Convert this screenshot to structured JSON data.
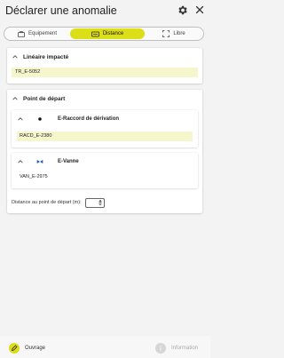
{
  "header": {
    "title": "Déclarer une anomalie",
    "settings_icon": "gear-icon",
    "close_icon": "close-icon"
  },
  "tabs": [
    {
      "label": "Equipement",
      "icon": "equipment-icon",
      "active": false
    },
    {
      "label": "Distance",
      "icon": "distance-icon",
      "active": true
    },
    {
      "label": "Libre",
      "icon": "free-select-icon",
      "active": false
    }
  ],
  "accent_color": "#dcde18",
  "lineaire": {
    "title": "Linéaire impacté",
    "value": "TR_E-5052"
  },
  "depart": {
    "title": "Point de départ",
    "items": [
      {
        "name": "E-Raccord de dérivation",
        "value": "RACD_E-2380",
        "icon": "dot-icon",
        "highlighted": true
      },
      {
        "name": "E-Vanne",
        "value": "VAN_E-2975",
        "icon": "valve-icon",
        "highlighted": false
      }
    ],
    "distance_label": "Distance au point de départ (m):",
    "distance_value": "0"
  },
  "footer": {
    "left_label": "Ouvrage",
    "right_label": "Information"
  }
}
